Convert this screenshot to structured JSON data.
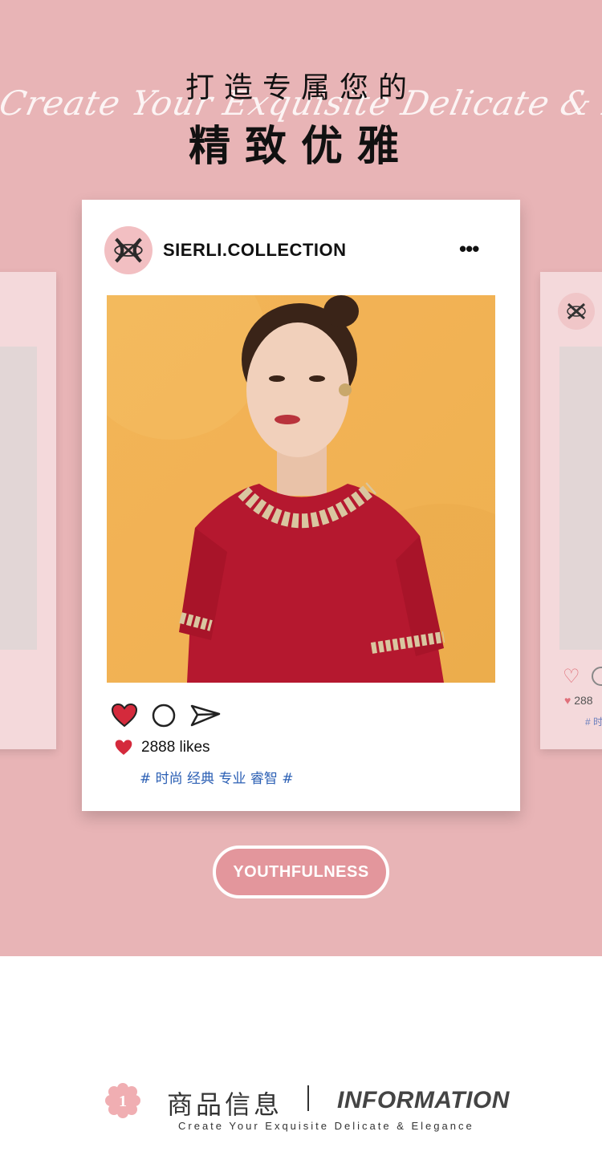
{
  "header": {
    "title_line1": "打造专属您的",
    "script_text": "Create Your Exquisite Delicate & Elegance",
    "title_line2": "精致优雅"
  },
  "post": {
    "account_name": "SIERLI.COLLECTION",
    "more_label": "•••",
    "likes_text": "2888 likes",
    "hashtags": "# 时尚 经典 专业 睿智 #",
    "accent_color": "#d42a3c"
  },
  "side_post": {
    "likes_partial": "288",
    "tags_partial": "# 时"
  },
  "badge": {
    "label": "YOUTHFULNESS"
  },
  "section": {
    "number": "1",
    "title_cn": "商品信息",
    "title_en": "INFORMATION",
    "subtitle": "Create Your Exquisite Delicate & Elegance"
  },
  "colors": {
    "background_pink": "#e8b4b6",
    "card_pink": "#f4d9db",
    "hashtag_blue": "#2b5fb4"
  }
}
